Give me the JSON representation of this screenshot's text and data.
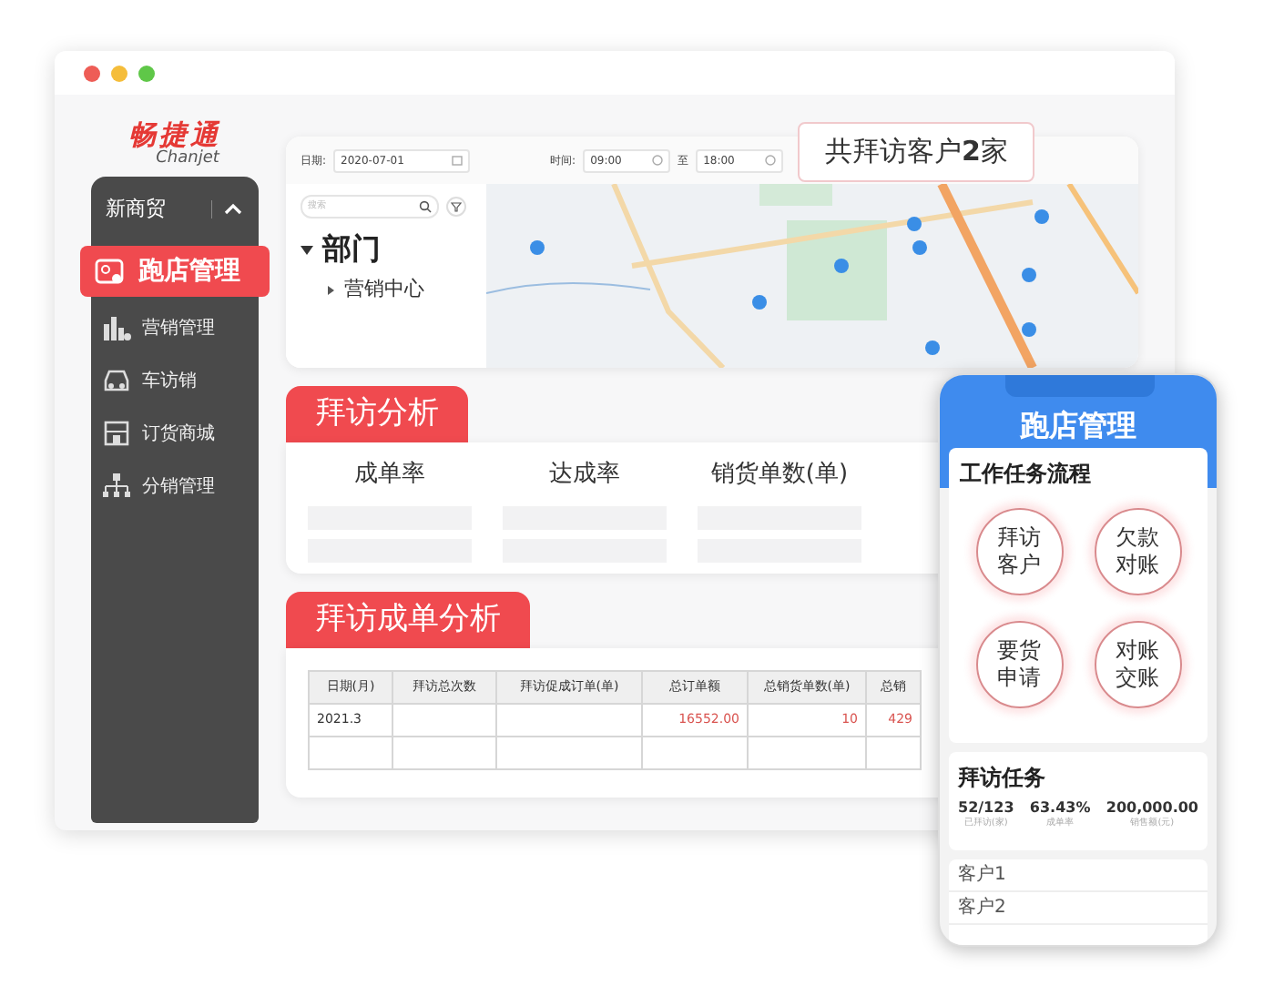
{
  "logo": {
    "name": "畅捷通",
    "subtitle": "Chanjet"
  },
  "sidebar": {
    "header": "新商贸",
    "items": [
      {
        "label": "跑店管理",
        "selected": true,
        "kind": "card"
      },
      {
        "label": "营销管理",
        "selected": false,
        "kind": "bars"
      },
      {
        "label": "车访销",
        "selected": false,
        "kind": "car"
      },
      {
        "label": "订货商城",
        "selected": false,
        "kind": "store"
      },
      {
        "label": "分销管理",
        "selected": false,
        "kind": "org"
      }
    ]
  },
  "filters": {
    "date_label": "日期:",
    "date_value": "2020-07-01",
    "time_label": "时间:",
    "time_from": "09:00",
    "to_label": "至",
    "time_to": "18:00"
  },
  "tree": {
    "search_placeholder": "搜索",
    "root": {
      "label": "部门",
      "expanded": true,
      "children": [
        {
          "label": "营销中心",
          "expanded": false
        }
      ]
    }
  },
  "callout": {
    "text": "共拜访客户**2**家"
  },
  "visit_analysis": {
    "title": "拜访分析",
    "columns": [
      "成单率",
      "达成率",
      "销货单数(单)"
    ]
  },
  "order_analysis": {
    "title": "拜访成单分析",
    "columns": [
      "日期(月)",
      "拜访总次数",
      "拜访促成订单(单)",
      "总订单额",
      "总销货单数(单)",
      "总销"
    ],
    "rows": [
      {
        "cells": [
          "2021.3",
          null,
          null,
          "16552.00",
          "10",
          "429"
        ]
      },
      {
        "cells": [
          null,
          null,
          null,
          null,
          null,
          null
        ]
      }
    ]
  },
  "phone": {
    "title": "跑店管理",
    "workflow_title": "工作任务流程",
    "steps": [
      "拜访客户",
      "欠款对账",
      "要货申请",
      "对账交账"
    ],
    "tasks_title": "拜访任务",
    "stats": [
      {
        "value": "52/123",
        "label": "已拜访(家)"
      },
      {
        "value": "63.43%",
        "label": "成单率"
      },
      {
        "value": "200,000.00",
        "label": "销售额(元)"
      }
    ],
    "customers": [
      "客户1",
      "客户2"
    ]
  }
}
